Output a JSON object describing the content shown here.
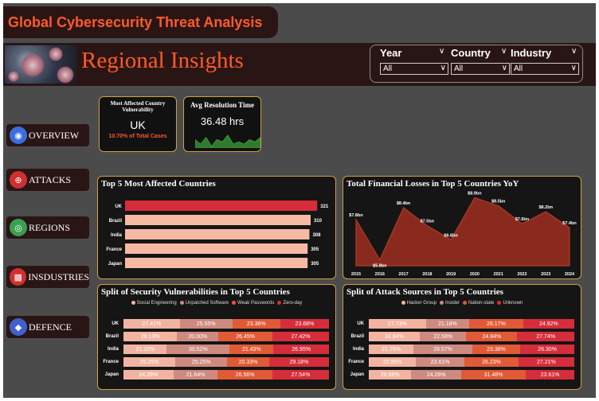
{
  "app_title": "Global Cybersecurity Threat Analysis",
  "page_title": "Regional Insights",
  "filters": [
    {
      "label": "Year",
      "value": "All"
    },
    {
      "label": "Country",
      "value": "All"
    },
    {
      "label": "Industry",
      "value": "All"
    }
  ],
  "nav": [
    {
      "label": "OVERVIEW",
      "icon": "overview-icon",
      "color": "#3a6ee0"
    },
    {
      "label": "ATTACKS",
      "icon": "attack-target-icon",
      "color": "#d03030"
    },
    {
      "label": "REGIONS",
      "icon": "globe-icon",
      "color": "#3aa050"
    },
    {
      "label": "INSDUSTRIES",
      "icon": "industry-icon",
      "color": "#d03030"
    },
    {
      "label": "DEFENCE",
      "icon": "shield-icon",
      "color": "#4060d0"
    }
  ],
  "kpi_country": {
    "title": "Most Affected Country Vulnerability",
    "value": "UK",
    "sub": "10.70% of Total Cases"
  },
  "kpi_resolution": {
    "title": "Avg Resolution Time",
    "value": "36.48 hrs",
    "sparkline": [
      5,
      3,
      6,
      2,
      5,
      4,
      7,
      3,
      4,
      3,
      5,
      4,
      6
    ]
  },
  "chart_data": [
    {
      "type": "bar",
      "orientation": "horizontal",
      "title": "Top 5 Most Affected Countries",
      "categories": [
        "UK",
        "Brazil",
        "India",
        "France",
        "Japan"
      ],
      "values": [
        321,
        310,
        308,
        305,
        305
      ],
      "colors": [
        "#d62d3a",
        "#f6b9a4",
        "#f6b9a4",
        "#f6b9a4",
        "#f6b9a4"
      ]
    },
    {
      "type": "area",
      "title": "Total Financial Losses in Top 5 Countries YoY",
      "x": [
        "2015",
        "2016",
        "2017",
        "2018",
        "2019",
        "2020",
        "2021",
        "2022",
        "2023",
        "2024"
      ],
      "y": [
        7.8,
        5.8,
        8.4,
        7.5,
        6.8,
        8.9,
        8.5,
        7.6,
        8.2,
        7.4
      ],
      "labels": [
        "$7.8bn",
        "$5.8bn",
        "$8.4bn",
        "$7.5bn",
        "$6.8bn",
        "$8.9bn",
        "$8.5bn",
        "$7.6bn",
        "$8.2bn",
        "$7.4bn"
      ],
      "color": "#8a2a1e"
    },
    {
      "type": "bar",
      "stacked": "percent",
      "orientation": "horizontal",
      "title": "Split of Security Vulnerabilities in Top 5 Countries",
      "categories": [
        "UK",
        "Brazil",
        "India",
        "France",
        "Japan"
      ],
      "series": [
        {
          "name": "Social Engineering",
          "color": "#f2b4a0",
          "values": [
            27.41,
            26.13,
            21.1,
            25.25,
            24.26
          ],
          "labels": [
            "27.41%",
            "26.13%",
            "21.10%",
            "25.25%",
            "24.26%"
          ]
        },
        {
          "name": "Unpatched Software",
          "color": "#cf8a80",
          "values": [
            25.55,
            20.0,
            30.52,
            25.25,
            21.64
          ],
          "labels": [
            "25.55%",
            "20.00%",
            "30.52%",
            "25.25%",
            "21.64%"
          ]
        },
        {
          "name": "Weak Passwords",
          "color": "#e05a36",
          "values": [
            23.36,
            26.45,
            21.43,
            20.33,
            26.56
          ],
          "labels": [
            "23.36%",
            "26.45%",
            "21.43%",
            "20.33%",
            "26.56%"
          ]
        },
        {
          "name": "Zero-day",
          "color": "#d62d3a",
          "values": [
            23.68,
            27.42,
            26.95,
            29.18,
            27.54
          ],
          "labels": [
            "23.68%",
            "27.42%",
            "26.95%",
            "29.18%",
            "27.54%"
          ]
        }
      ]
    },
    {
      "type": "bar",
      "stacked": "percent",
      "orientation": "horizontal",
      "title": "Split of Attack Sources in Top 5 Countries",
      "categories": [
        "UK",
        "Brazil",
        "India",
        "France",
        "Japan"
      ],
      "series": [
        {
          "name": "Hacker Group",
          "color": "#f2b4a0",
          "values": [
            27.73,
            24.84,
            21.75,
            22.95,
            20.66
          ],
          "labels": [
            "27.73%",
            "24.84%",
            "21.75%",
            "22.95%",
            "20.66%"
          ]
        },
        {
          "name": "Insider",
          "color": "#cf8a80",
          "values": [
            21.18,
            22.58,
            28.57,
            23.61,
            24.26
          ],
          "labels": [
            "21.18%",
            "22.58%",
            "28.57%",
            "23.61%",
            "24.26%"
          ]
        },
        {
          "name": "Nation-state",
          "color": "#e05a36",
          "values": [
            26.17,
            24.84,
            23.38,
            26.23,
            31.48
          ],
          "labels": [
            "26.17%",
            "24.84%",
            "23.38%",
            "26.23%",
            "31.48%"
          ]
        },
        {
          "name": "Unknown",
          "color": "#d62d3a",
          "values": [
            24.92,
            27.74,
            26.3,
            27.21,
            23.61
          ],
          "labels": [
            "24.92%",
            "27.74%",
            "26.30%",
            "27.21%",
            "23.61%"
          ]
        }
      ]
    }
  ]
}
